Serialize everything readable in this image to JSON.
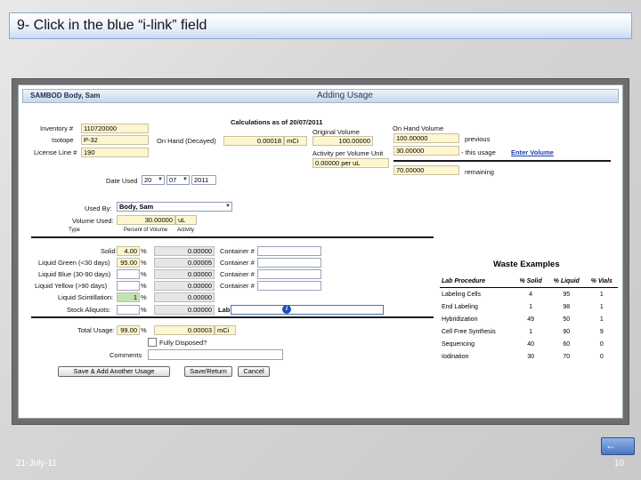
{
  "slide": {
    "title": "9- Click in the blue “i-link” field",
    "footer_date": "21-July-11",
    "page_number": "10",
    "back_icon": "back-arrow-icon"
  },
  "app": {
    "header_name": "SAMBOD   Body, Sam",
    "header_title": "Adding Usage",
    "calc_title": "Calculations as of 20/07/2011",
    "inventory_label": "Inventory #",
    "inventory_value": "110720000",
    "isotope_label": "Isotope",
    "isotope_value": "P-32",
    "license_label": "License Line #",
    "license_value": "190",
    "on_hand_decayed_label": "On Hand (Decayed)",
    "on_hand_decayed_value": "0.00018",
    "on_hand_decayed_unit": "mCi",
    "original_volume_label": "Original Volume",
    "original_volume_value": "100.00000",
    "activity_label": "Activity per Volume Unit",
    "activity_value": "0.00000 per uL",
    "on_hand_volume_label": "On Hand Volume",
    "on_hand_volume_value": "100.00000",
    "previous_label": "previous",
    "this_usage_value": "30.00000",
    "this_usage_label": "- this usage",
    "enter_volume_link": "Enter Volume",
    "remaining_value": "70.00000",
    "remaining_label": "remaining",
    "date_used_label": "Date Used",
    "date_day": "20",
    "date_month": "07",
    "date_year": "2011",
    "used_by_label": "Used By:",
    "used_by_value": "Body, Sam",
    "volume_used_label": "Volume Used:",
    "volume_used_value": "30.00000",
    "volume_used_unit": "uL",
    "col_type": "Type",
    "col_percent": "Percent of Volume",
    "col_activity": "Activity",
    "waste_rows": [
      {
        "label": "Solid",
        "percent": "4.00",
        "activity": "0.00000",
        "container_label": "Container #"
      },
      {
        "label": "Liquid Green (<30 days)",
        "percent": "95.00",
        "activity": "0.00005",
        "container_label": "Container #"
      },
      {
        "label": "Liquid Blue (30-90 days)",
        "percent": "",
        "activity": "0.00000",
        "container_label": "Container #"
      },
      {
        "label": "Liquid Yellow (>90 days)",
        "percent": "",
        "activity": "0.00000",
        "container_label": "Container #"
      },
      {
        "label": "Liquid Scintillation:",
        "percent": "1",
        "activity": "0.00000",
        "container_label": ""
      },
      {
        "label": "Stock Aliquots:",
        "percent": "",
        "activity": "0.00000",
        "container_label": "Lab"
      }
    ],
    "percent_sign": "%",
    "total_usage_label": "Total Usage:",
    "total_usage_percent": "99.00",
    "total_usage_activity": "0.00003",
    "total_usage_unit": "mCi",
    "fully_disposed_label": "Fully Disposed?",
    "comments_label": "Comments",
    "save_add_button": "Save & Add Another Usage",
    "save_return_button": "Save/Return",
    "cancel_button": "Cancel"
  },
  "waste_examples": {
    "title": "Waste Examples",
    "headers": [
      "Lab Procedure",
      "% Solid",
      "% Liquid",
      "% Vials"
    ],
    "rows": [
      [
        "Labeling Cells",
        "4",
        "95",
        "1"
      ],
      [
        "End Labeling",
        "1",
        "98",
        "1"
      ],
      [
        "Hybridization",
        "49",
        "50",
        "1"
      ],
      [
        "Cell Free Synthesis",
        "1",
        "90",
        "9"
      ],
      [
        "Sequencing",
        "40",
        "60",
        "0"
      ],
      [
        "Iodination",
        "30",
        "70",
        "0"
      ]
    ]
  }
}
